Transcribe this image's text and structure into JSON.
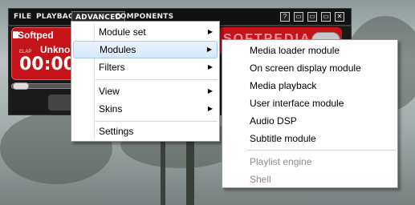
{
  "menubar": {
    "items": [
      "FILE",
      "PLAYBACK",
      "ADVANCED",
      "COMPONENTS"
    ],
    "window_buttons": [
      "?",
      "▭",
      "▭",
      "▭",
      "✕"
    ]
  },
  "player": {
    "brand": "Softped",
    "track": "Unkno",
    "elapsed_label": "ELAP",
    "time": "00:00",
    "watermark": "SOFTPEDIA",
    "colors": {
      "display": "#c4141a",
      "frame": "#1a1a1a"
    }
  },
  "advanced_menu": {
    "items": [
      {
        "label": "Module set",
        "submenu": true
      },
      {
        "label": "Modules",
        "submenu": true,
        "highlighted": true
      },
      {
        "label": "Filters",
        "submenu": true
      },
      {
        "label": "View",
        "submenu": true
      },
      {
        "label": "Skins",
        "submenu": true
      },
      {
        "label": "Settings",
        "submenu": false
      }
    ]
  },
  "modules_submenu": {
    "items": [
      {
        "label": "Media loader module",
        "enabled": true
      },
      {
        "label": "On screen display module",
        "enabled": true
      },
      {
        "label": "Media playback",
        "enabled": true
      },
      {
        "label": "User interface module",
        "enabled": true
      },
      {
        "label": "Audio DSP",
        "enabled": true
      },
      {
        "label": "Subtitle module",
        "enabled": true
      },
      {
        "label": "Playlist engine",
        "enabled": false
      },
      {
        "label": "Shell",
        "enabled": false
      }
    ]
  },
  "icons": {
    "submenu_arrow": "chevron-right-icon"
  }
}
